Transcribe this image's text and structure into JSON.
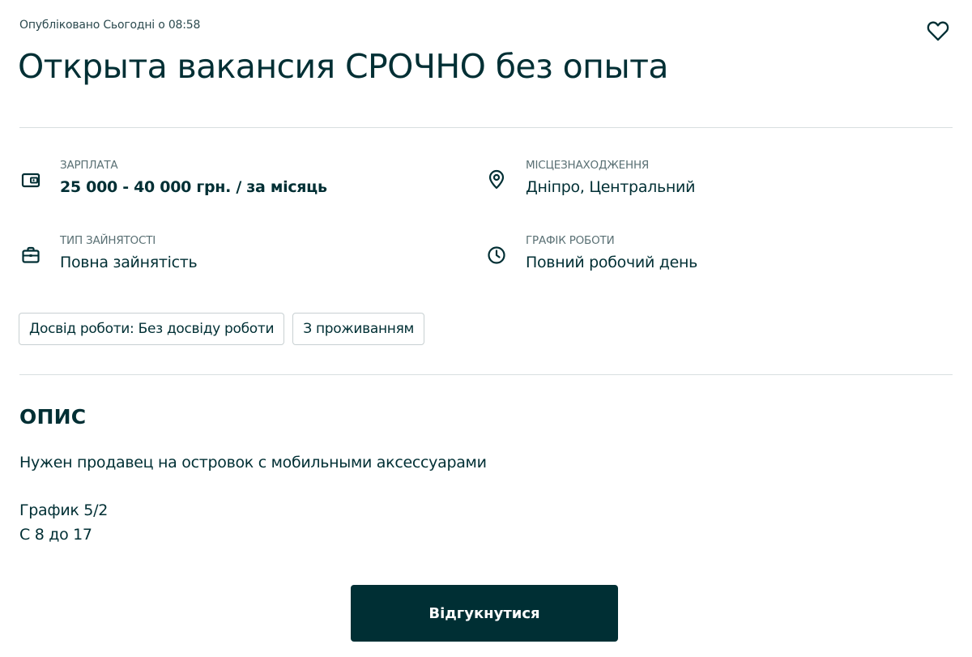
{
  "header": {
    "published": "Опубліковано Сьогодні о 08:58",
    "title": "Открыта вакансия СРОЧНО без опыта",
    "favorite_icon": "heart-outline-icon"
  },
  "params": {
    "salary": {
      "label": "ЗАРПЛАТА",
      "value": "25 000 - 40 000 грн. / за місяць",
      "icon": "wallet-icon"
    },
    "location": {
      "label": "МІСЦЕЗНАХОДЖЕННЯ",
      "value": "Дніпро, Центральний",
      "icon": "location-pin-icon"
    },
    "employment": {
      "label": "ТИП ЗАЙНЯТОСТІ",
      "value": "Повна зайнятість",
      "icon": "briefcase-icon"
    },
    "schedule": {
      "label": "ГРАФІК РОБОТИ",
      "value": "Повний робочий день",
      "icon": "clock-icon"
    }
  },
  "tags": [
    "Досвід роботи: Без досвіду роботи",
    "З проживанням"
  ],
  "description": {
    "heading": "ОПИС",
    "lines": [
      "Нужен продавец на островок с мобильными аксессуарами",
      "График 5/2",
      "С 8 до 17"
    ]
  },
  "actions": {
    "apply_label": "Відгукнутися"
  },
  "colors": {
    "primary": "#002f34",
    "divider": "#d8dfe0",
    "label": "#5a7074"
  }
}
